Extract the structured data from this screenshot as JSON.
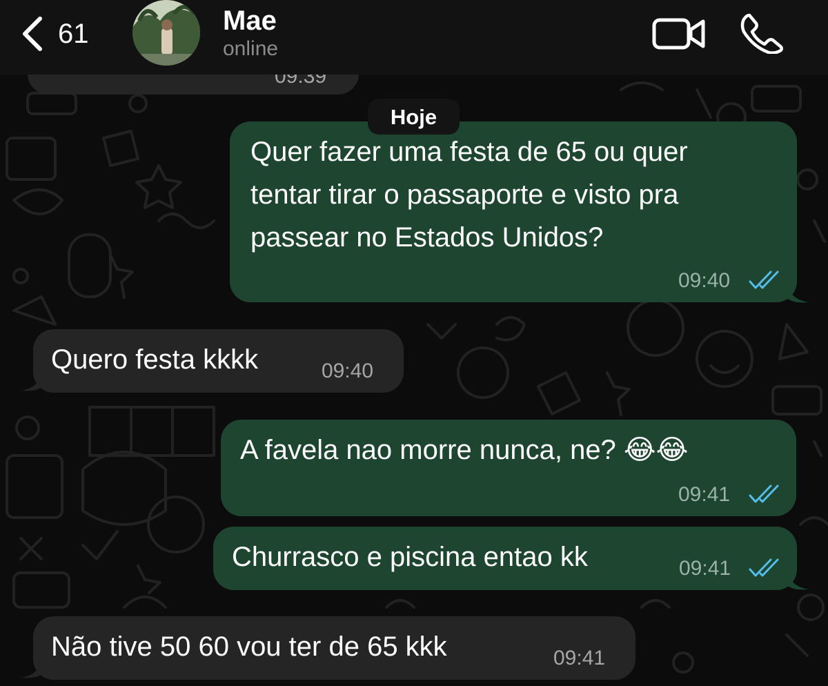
{
  "header": {
    "back_count": "61",
    "contact_name": "Mae",
    "contact_status": "online",
    "back_icon": "chevron-left-icon",
    "video_icon": "video-camera-icon",
    "call_icon": "phone-icon"
  },
  "chat": {
    "date_separator": "Hoje",
    "previous_time_partial": "09:39",
    "messages": [
      {
        "direction": "outgoing",
        "lines": [
          "Quer fazer uma festa de 65 ou quer",
          "tentar tirar o passaporte e visto pra",
          "passear no Estados Unidos?"
        ],
        "time": "09:40",
        "status": "read"
      },
      {
        "direction": "incoming",
        "lines": [
          "Quero festa kkkk"
        ],
        "time": "09:40"
      },
      {
        "direction": "outgoing",
        "lines": [
          "A favela nao morre nunca, ne? 😂😂"
        ],
        "time": "09:41",
        "status": "read"
      },
      {
        "direction": "outgoing",
        "lines": [
          "Churrasco e piscina entao kk"
        ],
        "time": "09:41",
        "status": "read"
      },
      {
        "direction": "incoming",
        "lines": [
          "Não tive 50 60 vou ter de 65 kkk"
        ],
        "time": "09:41"
      }
    ]
  },
  "colors": {
    "outgoing_bubble": "#1e4530",
    "incoming_bubble": "#252525",
    "read_ticks": "#53bdeb",
    "background": "#0c0c0c"
  }
}
